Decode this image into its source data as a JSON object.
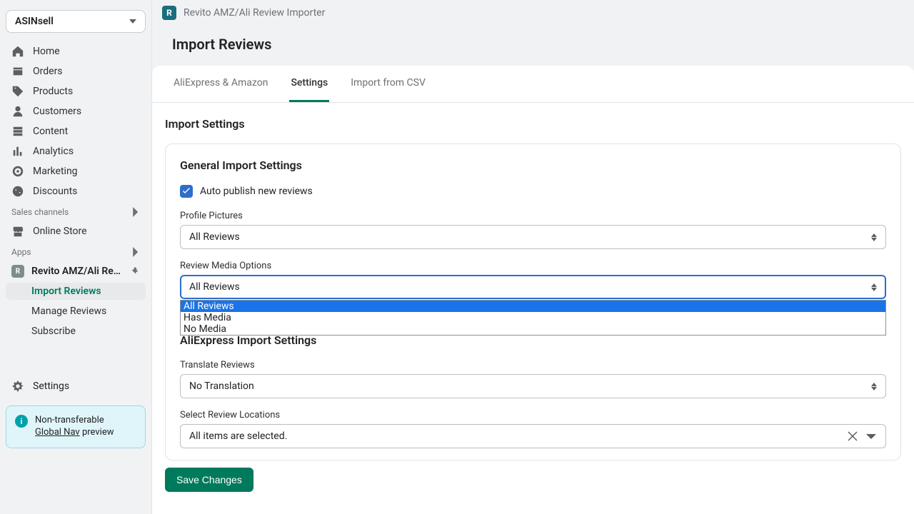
{
  "store": {
    "name": "ASINsell"
  },
  "sidebar": {
    "nav": [
      {
        "label": "Home"
      },
      {
        "label": "Orders"
      },
      {
        "label": "Products"
      },
      {
        "label": "Customers"
      },
      {
        "label": "Content"
      },
      {
        "label": "Analytics"
      },
      {
        "label": "Marketing"
      },
      {
        "label": "Discounts"
      }
    ],
    "salesChannels": {
      "title": "Sales channels",
      "items": [
        {
          "label": "Online Store"
        }
      ]
    },
    "apps": {
      "title": "Apps",
      "items": [
        {
          "label": "Revito AMZ/Ali Revi…"
        }
      ],
      "sub": [
        {
          "label": "Import Reviews"
        },
        {
          "label": "Manage Reviews"
        },
        {
          "label": "Subscribe"
        }
      ]
    },
    "settings": "Settings"
  },
  "notice": {
    "line1": "Non-transferable",
    "link": "Global Nav",
    "line2": " preview"
  },
  "header": {
    "appName": "Revito AMZ/Ali Review Importer"
  },
  "page": {
    "title": "Import Reviews"
  },
  "tabs": [
    {
      "label": "AliExpress & Amazon"
    },
    {
      "label": "Settings"
    },
    {
      "label": "Import from CSV"
    }
  ],
  "settings": {
    "title": "Import Settings",
    "general": {
      "title": "General Import Settings",
      "autoPublish": "Auto publish new reviews",
      "profilePictures": {
        "label": "Profile Pictures",
        "value": "All Reviews"
      },
      "reviewMedia": {
        "label": "Review Media Options",
        "value": "All Reviews",
        "options": [
          "All Reviews",
          "Has Media",
          "No Media"
        ]
      }
    },
    "aliexpress": {
      "title": "AliExpress Import Settings",
      "translate": {
        "label": "Translate Reviews",
        "value": "No Translation"
      },
      "locations": {
        "label": "Select Review Locations",
        "value": "All items are selected."
      }
    },
    "saveBtn": "Save Changes"
  }
}
